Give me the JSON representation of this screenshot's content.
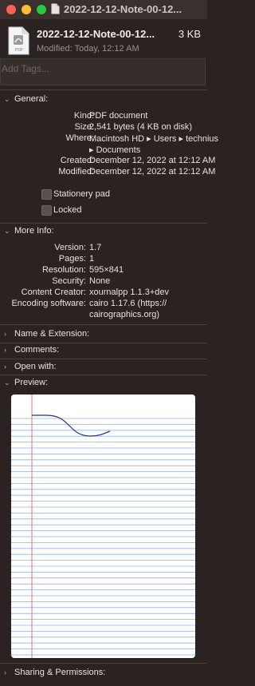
{
  "window": {
    "title": "2022-12-12-Note-00-12..."
  },
  "file": {
    "name": "2022-12-12-Note-00-12...",
    "size": "3 KB",
    "modified": "Modified: Today, 12:12 AM",
    "icon_label": "PDF"
  },
  "tags": {
    "placeholder": "Add Tags..."
  },
  "general": {
    "header": "General:",
    "rows": {
      "kind": {
        "label": "Kind:",
        "value": "PDF document"
      },
      "size": {
        "label": "Size:",
        "value": "2,541 bytes (4 KB on disk)"
      },
      "where": {
        "label": "Where:",
        "value_line1": "Macintosh HD ▸ Users ▸ technius",
        "value_line2": "▸ Documents"
      },
      "created": {
        "label": "Created:",
        "value": "December 12, 2022 at 12:12 AM"
      },
      "modified": {
        "label": "Modified:",
        "value": "December 12, 2022 at 12:12 AM"
      }
    },
    "stationery_pad": {
      "label": "Stationery pad",
      "checked": false
    },
    "locked": {
      "label": "Locked",
      "checked": false
    }
  },
  "more_info": {
    "header": "More Info:",
    "rows": {
      "version": {
        "label": "Version:",
        "value": "1.7"
      },
      "pages": {
        "label": "Pages:",
        "value": "1"
      },
      "resolution": {
        "label": "Resolution:",
        "value": "595×841"
      },
      "security": {
        "label": "Security:",
        "value": "None"
      },
      "content_creator": {
        "label": "Content Creator:",
        "value": "xournalpp 1.1.3+dev"
      },
      "encoding_software": {
        "label": "Encoding software:",
        "value_line1": "cairo 1.17.6 (https://",
        "value_line2": "cairographics.org)"
      }
    }
  },
  "sections": {
    "name_extension": "Name & Extension:",
    "comments": "Comments:",
    "open_with": "Open with:",
    "preview": "Preview:",
    "sharing": "Sharing & Permissions:"
  },
  "colors": {
    "background": "#2b2321",
    "ruled_line": "#8fb0e8",
    "margin_line": "#e57373",
    "ink": "#2a2a8c"
  }
}
